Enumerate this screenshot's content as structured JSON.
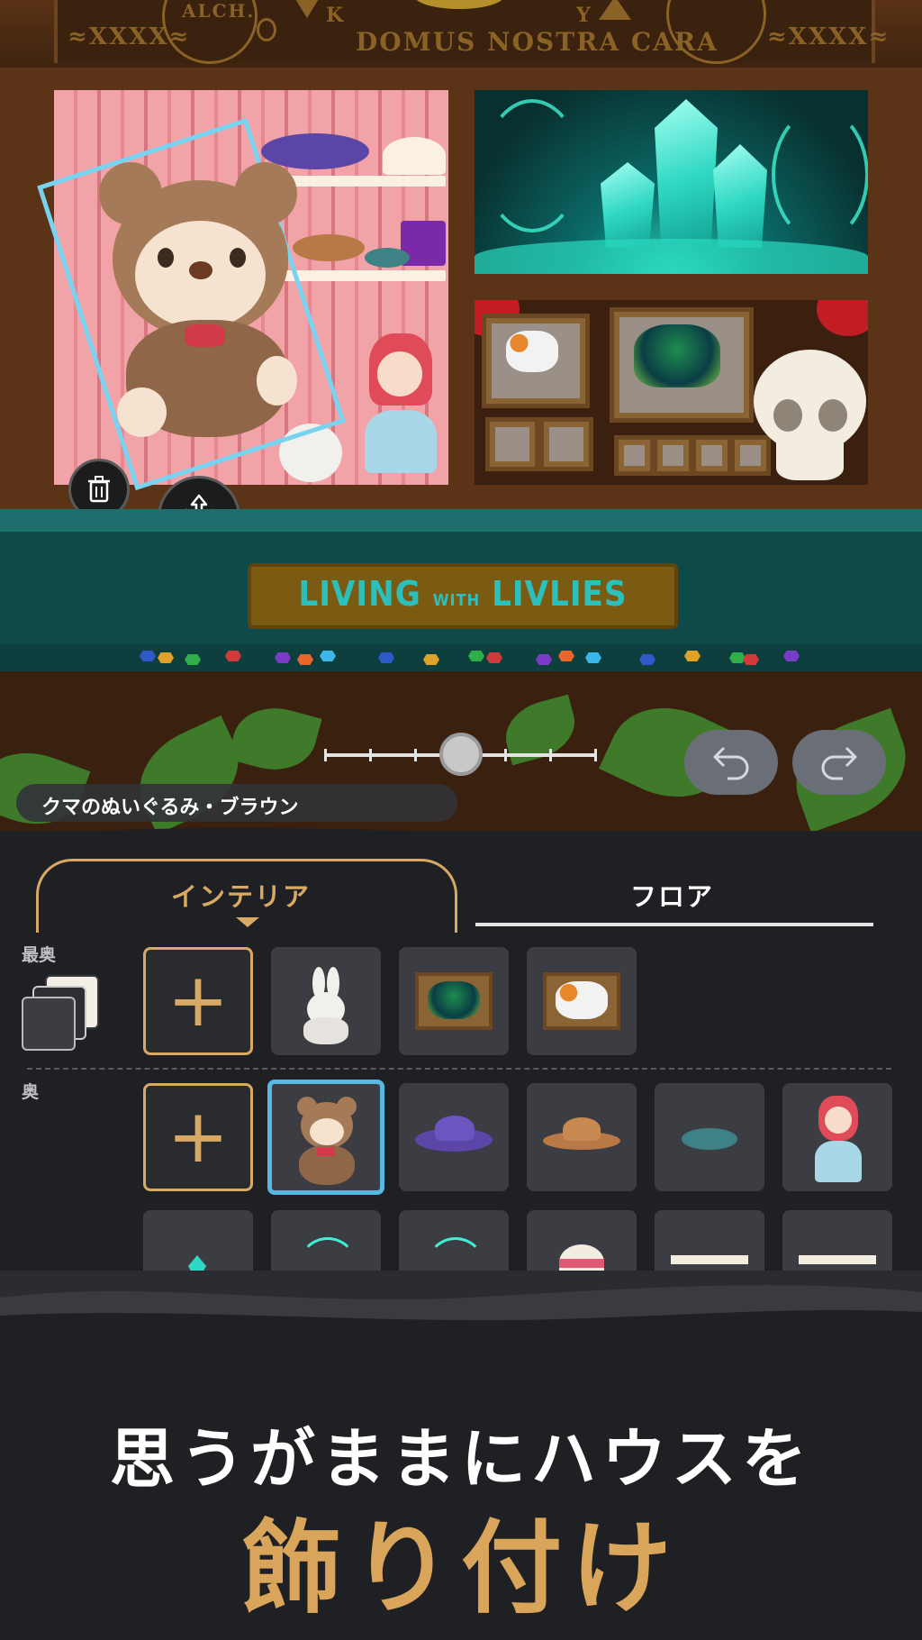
{
  "header": {
    "left_ornament": "≈XXXX≈",
    "right_ornament": "≈XXXX≈",
    "circle_label": "ALCH.",
    "letter_k": "K",
    "letter_y": "Y",
    "title": "DOMUS NOSTRA CARA"
  },
  "sign": {
    "part1": "LIVING",
    "part2": "WITH",
    "part3": "LIVLIES"
  },
  "selected_item": {
    "name": "クマのぬいぐるみ・ブラウン"
  },
  "layer_slider": {
    "steps": 7,
    "selected_step": 3
  },
  "tabs": [
    {
      "label": "インテリア",
      "active": true
    },
    {
      "label": "フロア",
      "active": false
    }
  ],
  "layers": [
    {
      "label": "最奥",
      "items": [
        "add",
        "rabbit-figurine",
        "green-butterfly-frame",
        "white-butterfly-frame"
      ]
    },
    {
      "label": "奥",
      "items": [
        "add",
        "brown-teddy-bear",
        "purple-hat",
        "straw-hat",
        "teal-shoes",
        "doll-girl"
      ]
    },
    {
      "items": [
        "crystal",
        "glowing-vine-1",
        "glowing-vine-2",
        "pink-hat",
        "white-shelf-1",
        "white-shelf-2"
      ]
    }
  ],
  "promo": {
    "line1": "思うがままにハウスを",
    "line2": "飾り付け"
  },
  "colors": {
    "accent_gold": "#d8a865",
    "selection_blue": "#58b7e3",
    "panel_bg": "#1f2023"
  }
}
